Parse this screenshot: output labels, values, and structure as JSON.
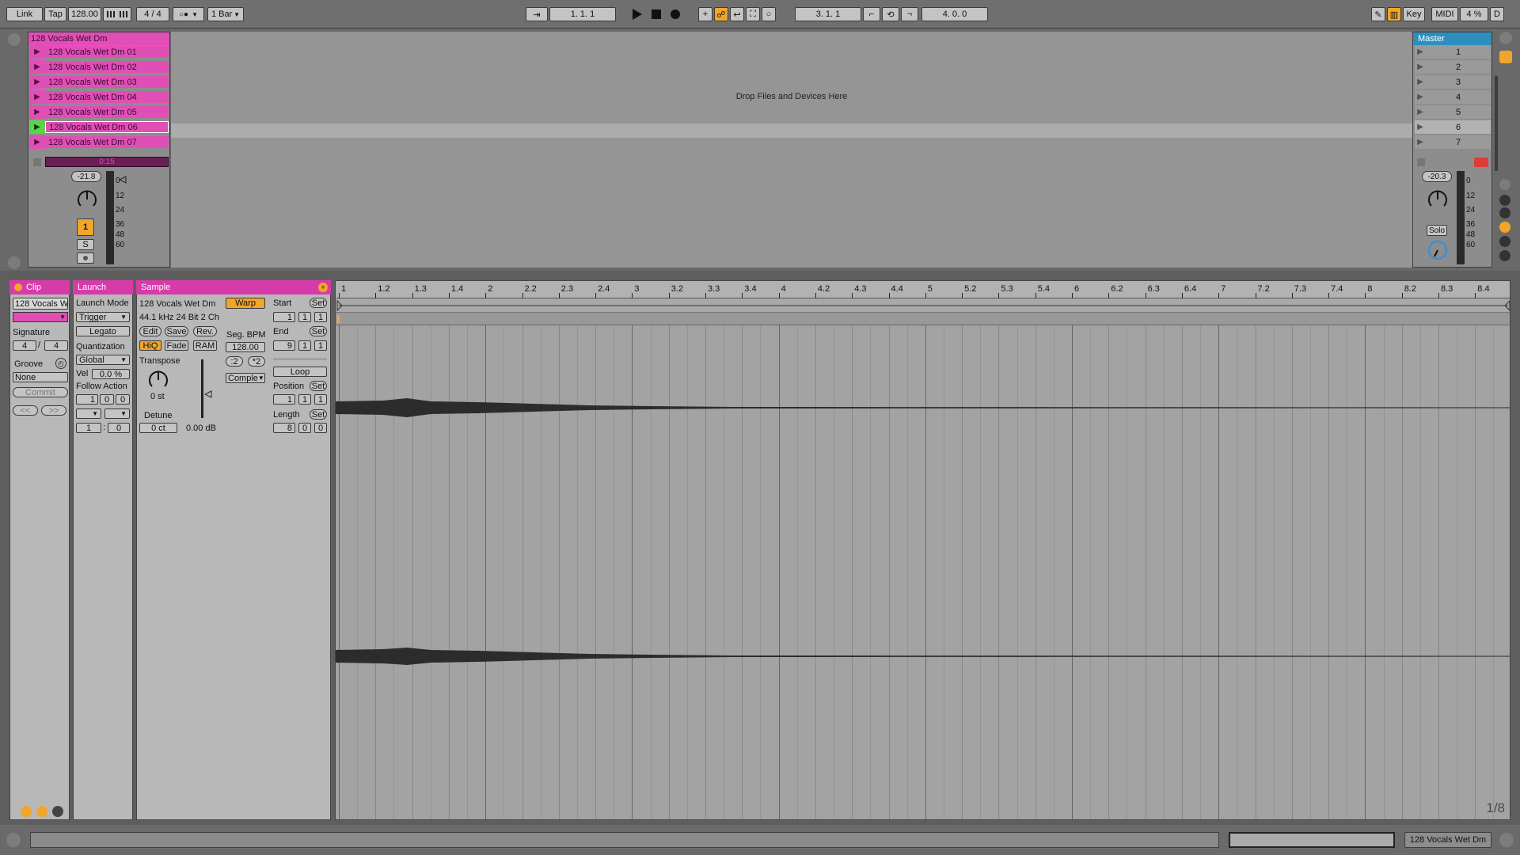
{
  "transport": {
    "link": "Link",
    "tap": "Tap",
    "tempo": "128.00",
    "time_sig": "4 / 4",
    "quantize": "1 Bar",
    "position": "1.   1.   1",
    "loop_start": "3.   1.   1",
    "loop_length": "4.   0.   0",
    "key": "Key",
    "midi": "MIDI",
    "cpu": "4 %",
    "d": "D"
  },
  "track": {
    "name": "128 Vocals Wet Dm",
    "clips": [
      "128 Vocals Wet Dm 01",
      "128 Vocals Wet Dm 02",
      "128 Vocals Wet Dm 03",
      "128 Vocals Wet Dm 04",
      "128 Vocals Wet Dm 05",
      "128 Vocals Wet Dm 06",
      "128 Vocals Wet Dm 07"
    ],
    "playing_index": 5,
    "progress_label": "0:15",
    "volume": "-21.8",
    "track_number": "1",
    "solo": "S",
    "meter_scale": [
      "0",
      "12",
      "24",
      "36",
      "48",
      "60"
    ]
  },
  "drop_zone": "Drop Files and Devices Here",
  "master": {
    "name": "Master",
    "scenes": [
      "1",
      "2",
      "3",
      "4",
      "5",
      "6",
      "7"
    ],
    "volume": "-20.3",
    "solo": "Solo",
    "meter_scale": [
      "0",
      "12",
      "24",
      "36",
      "48",
      "60"
    ]
  },
  "clip_panel": {
    "title": "Clip",
    "name": "128 Vocals W",
    "signature_label": "Signature",
    "sig_num": "4",
    "sig_den": "4",
    "groove_label": "Groove",
    "groove_value": "None",
    "commit": "Commit",
    "nudge_back": "<<",
    "nudge_fwd": ">>"
  },
  "launch_panel": {
    "title": "Launch",
    "mode_label": "Launch Mode",
    "mode_value": "Trigger",
    "legato": "Legato",
    "quant_label": "Quantization",
    "quant_value": "Global",
    "vel_label": "Vel",
    "vel_value": "0.0 %",
    "follow_label": "Follow Action",
    "fa_1": "1",
    "fa_2": "0",
    "fa_3": "0",
    "fa_a": "1",
    "fa_b": "0"
  },
  "sample_panel": {
    "title": "Sample",
    "file_name": "128 Vocals Wet Dm",
    "file_info": "44.1 kHz 24 Bit 2 Ch",
    "edit": "Edit",
    "save": "Save",
    "rev": "Rev.",
    "hiq": "HiQ",
    "fade": "Fade",
    "ram": "RAM",
    "transpose_label": "Transpose",
    "transpose_value": "0 st",
    "detune_label": "Detune",
    "detune_value": "0 ct",
    "gain_value": "0.00 dB",
    "warp": "Warp",
    "seg_bpm_label": "Seg. BPM",
    "seg_bpm_value": "128.00",
    "half": ":2",
    "double": "*2",
    "warp_mode": "Comple",
    "start_label": "Start",
    "set": "Set",
    "start": [
      "1",
      "1",
      "1"
    ],
    "end_label": "End",
    "end": [
      "9",
      "1",
      "1"
    ],
    "loop": "Loop",
    "position_label": "Position",
    "position": [
      "1",
      "1",
      "1"
    ],
    "length_label": "Length",
    "length": [
      "8",
      "0",
      "0"
    ]
  },
  "ruler_labels": [
    "1",
    "1.2",
    "1.3",
    "1.4",
    "2",
    "2.2",
    "2.3",
    "2.4",
    "3",
    "3.2",
    "3.3",
    "3.4",
    "4",
    "4.2",
    "4.3",
    "4.4",
    "5",
    "5.2",
    "5.3",
    "5.4",
    "6",
    "6.2",
    "6.3",
    "6.4",
    "7",
    "7.2",
    "7.3",
    "7.4",
    "8",
    "8.2",
    "8.3",
    "8.4"
  ],
  "grid_zoom": "1/8",
  "status": {
    "selected": "128 Vocals Wet Dm"
  },
  "colors": {
    "clip_pink": "#e04fb6",
    "clip_pink_dark": "#d63ba9",
    "accent_orange": "#f0a62a",
    "play_green": "#5bd34b"
  }
}
